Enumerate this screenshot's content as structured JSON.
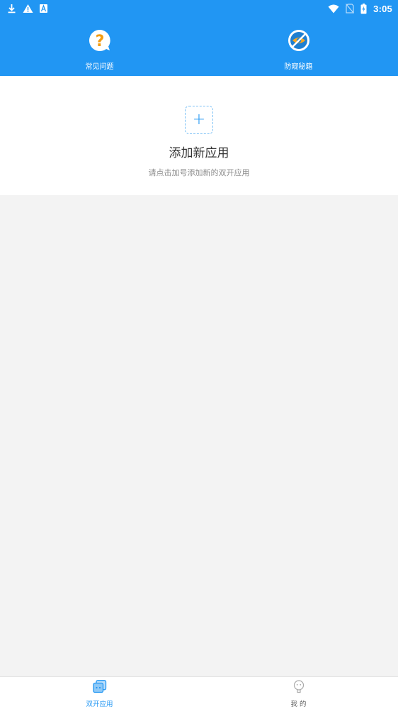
{
  "status_bar": {
    "time": "3:05",
    "left_icons": [
      "download-icon",
      "warning-icon",
      "font-a-icon"
    ],
    "right_icons": [
      "wifi-icon",
      "no-sim-icon",
      "battery-charging-icon"
    ]
  },
  "header": {
    "items": [
      {
        "label": "常见问题",
        "icon": "help-question-icon"
      },
      {
        "label": "防窥秘籍",
        "icon": "eye-slash-icon"
      }
    ]
  },
  "add_card": {
    "plus": "+",
    "title": "添加新应用",
    "subtitle": "请点击加号添加新的双开应用"
  },
  "bottom_nav": {
    "items": [
      {
        "label": "双开应用",
        "icon": "dual-app-icon",
        "active": true
      },
      {
        "label": "我 的",
        "icon": "profile-icon",
        "active": false
      }
    ]
  },
  "colors": {
    "primary": "#2196f3",
    "background": "#f3f3f3",
    "card": "#ffffff",
    "question_orange": "#f39c12"
  }
}
